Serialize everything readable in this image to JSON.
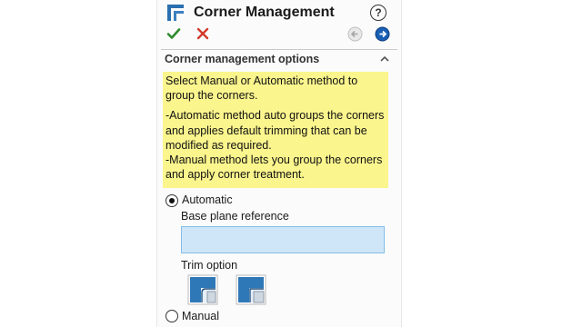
{
  "header": {
    "title": "Corner Management",
    "help_symbol": "?",
    "icon": "corner-management-icon"
  },
  "actions": {
    "ok_icon": "checkmark-icon",
    "cancel_icon": "x-icon",
    "back_icon": "back-arrow-icon",
    "forward_icon": "forward-arrow-icon",
    "colors": {
      "ok": "#2e8b2e",
      "cancel": "#d23a2a",
      "forward": "#1a5fb4"
    }
  },
  "group": {
    "title": "Corner management options",
    "info_paragraphs": [
      "Select Manual or Automatic method to group the corners.",
      "-Automatic method auto groups the corners and applies default trimming that can be modified as required.",
      "-Manual method lets you group the corners and apply corner treatment."
    ],
    "info_bg": "#fbf58d"
  },
  "options": {
    "automatic_label": "Automatic",
    "automatic_selected": true,
    "base_plane_label": "Base plane reference",
    "base_plane_value": "",
    "trim_label": "Trim option",
    "trim_icons": [
      "trim-option-1-icon",
      "trim-option-2-icon"
    ],
    "manual_label": "Manual",
    "manual_selected": false
  }
}
